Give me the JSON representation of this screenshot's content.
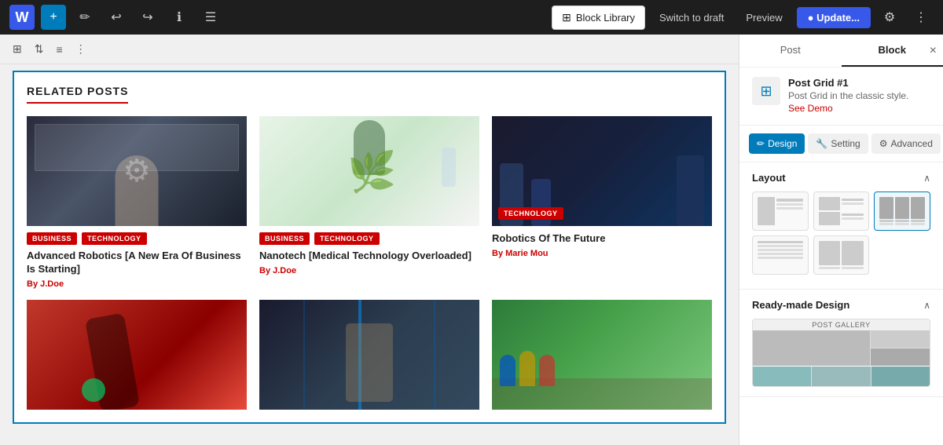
{
  "toolbar": {
    "add_icon": "+",
    "wp_logo": "W",
    "block_library_label": "Block Library",
    "switch_draft_label": "Switch to draft",
    "preview_label": "Preview",
    "update_label": "Update...",
    "undo_icon": "↩",
    "redo_icon": "↪",
    "info_icon": "ℹ",
    "list_icon": "☰",
    "pen_icon": "✏"
  },
  "block_toolbar": {
    "grid_icon": "⊞",
    "arrows_icon": "⇅",
    "hamburger_icon": "≡",
    "dots_icon": "⋮"
  },
  "content": {
    "section_title": "RELATED POSTS",
    "posts": [
      {
        "tags": [
          "BUSINESS",
          "TECHNOLOGY"
        ],
        "title": "Advanced Robotics [A New Era Of Business Is Starting]",
        "author_prefix": "By",
        "author": "J.Doe",
        "img_class": "img-robotics"
      },
      {
        "tags": [
          "BUSINESS",
          "TECHNOLOGY"
        ],
        "title": "Nanotech [Medical Technology Overloaded]",
        "author_prefix": "By",
        "author": "J.Doe",
        "img_class": "img-nanotech"
      },
      {
        "tags": [
          "TECHNOLOGY"
        ],
        "title": "Robotics Of The Future",
        "author_prefix": "By",
        "author": "Marie Mou",
        "img_class": "img-robots-future"
      }
    ],
    "posts_row2": [
      {
        "img_class": "img-running"
      },
      {
        "img_class": "img-datacenter"
      },
      {
        "img_class": "img-cycling"
      }
    ]
  },
  "sidebar": {
    "tab_post": "Post",
    "tab_block": "Block",
    "close_icon": "×",
    "block_name": "Post Grid #1",
    "block_description": "Post Grid in the classic style.",
    "see_demo": "See Demo",
    "tab_design": "Design",
    "tab_setting": "Setting",
    "tab_advanced": "Advanced",
    "layout_title": "Layout",
    "ready_made_title": "Ready-made Design",
    "layout_icon": "⊞"
  }
}
